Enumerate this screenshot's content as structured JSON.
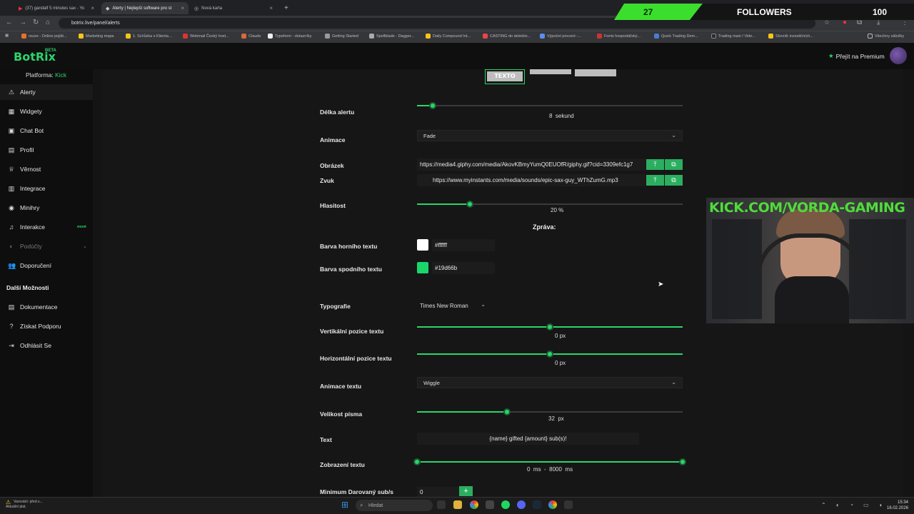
{
  "browser": {
    "tabs": [
      {
        "label": "(37) gandalf 5 minutes sax - Yo",
        "active": false
      },
      {
        "label": "Alerty | Nejlepší software pro st",
        "active": true
      },
      {
        "label": "Nová karta",
        "active": false
      }
    ],
    "url": "botrix.live/panel/alerts",
    "bookmarks": [
      "nsure - Online pojišt...",
      "Marketing mapa",
      "1. Schůzka s Klienta...",
      "Webmail Český host...",
      "Claude",
      "Typeform - dotazníky",
      "Getting Started",
      "Spellblade - Dagger...",
      "Daily Compound Int...",
      "CASTING do detektiv...",
      "Výpočet procent -...",
      "Fonts hospodářský...",
      "Quick Trading Dem...",
      "Trading main / Vide...",
      "Slovník investičních..."
    ],
    "bookmarks_end": "Všechny záložky"
  },
  "overlay": {
    "count": "27",
    "label": "FOLLOWERS",
    "goal": "100",
    "accent": "#3cde2e"
  },
  "app": {
    "logo": "BotRix",
    "beta": "BETA",
    "premium": "Přejít na Premium",
    "platform_label": "Platforma:",
    "platform_value": "Kick",
    "accent": "#2bd46b"
  },
  "sidebar": {
    "items": [
      {
        "label": "Alerty",
        "icon": "warning-icon"
      },
      {
        "label": "Widgety",
        "icon": "grid-icon"
      },
      {
        "label": "Chat Bot",
        "icon": "chat-icon"
      },
      {
        "label": "Profil",
        "icon": "profile-icon"
      },
      {
        "label": "Věrnost",
        "icon": "trophy-icon"
      },
      {
        "label": "Integrace",
        "icon": "puzzle-icon"
      },
      {
        "label": "Minihry",
        "icon": "gamepad-icon"
      },
      {
        "label": "Interakce",
        "icon": "music-icon",
        "badge": "nové"
      },
      {
        "label": "Podúčty",
        "icon": "subaccount-icon"
      },
      {
        "label": "Doporučení",
        "icon": "users-icon"
      }
    ],
    "section": "Další Možnosti",
    "more": [
      {
        "label": "Dokumentace",
        "icon": "book-icon"
      },
      {
        "label": "Získat Podporu",
        "icon": "help-icon"
      },
      {
        "label": "Odhlásit Se",
        "icon": "logout-icon"
      }
    ]
  },
  "form": {
    "tab_text": "TEXTO",
    "alert_length": {
      "label": "Délka alertu",
      "value": "8",
      "unit": "sekund",
      "fraction": 0.06
    },
    "animation": {
      "label": "Animace",
      "value": "Fade"
    },
    "image": {
      "label": "Obrázek",
      "value": "https://media4.giphy.com/media/AkovKBmyYumQ0EUOfR/giphy.gif?cid=3309efc1g7"
    },
    "sound": {
      "label": "Zvuk",
      "value": "https://www.myinstants.com/media/sounds/epic-sax-guy_WThZumG.mp3"
    },
    "volume": {
      "label": "Hlasitost",
      "value": "20",
      "unit": "%",
      "fraction": 0.2
    },
    "message_heading": "Zpráva:",
    "top_color": {
      "label": "Barva horního textu",
      "value": "#ffffff"
    },
    "bottom_color": {
      "label": "Barva spodního textu",
      "value": "#19d66b"
    },
    "typography": {
      "label": "Typografie",
      "value": "Times New Roman"
    },
    "vpos": {
      "label": "Vertikální pozice textu",
      "value": "0",
      "unit": "px",
      "fraction": 0.5
    },
    "hpos": {
      "label": "Horizontální pozice textu",
      "value": "0",
      "unit": "px",
      "fraction": 0.5
    },
    "text_anim": {
      "label": "Animace textu",
      "value": "Wiggle"
    },
    "font_size": {
      "label": "Velikost písma",
      "value": "32",
      "unit": "px",
      "fraction": 0.34
    },
    "text": {
      "label": "Text",
      "value": "{name} gifted {amount} sub(s)!"
    },
    "display": {
      "label": "Zobrazení textu",
      "min": "0",
      "max": "8000",
      "unit": "ms",
      "separator": "-"
    },
    "min_subs": {
      "label": "Minimum Darovaný sub/s",
      "value": "0"
    }
  },
  "webcam": {
    "overlay_text": "KICK.COM/VORDA-GAMING"
  },
  "taskbar": {
    "search": "Hledat",
    "notice_line1": "Varování: před s...",
    "notice_line2": "Aktuální plat.",
    "time": "15:34",
    "date": "16.02.2026"
  }
}
